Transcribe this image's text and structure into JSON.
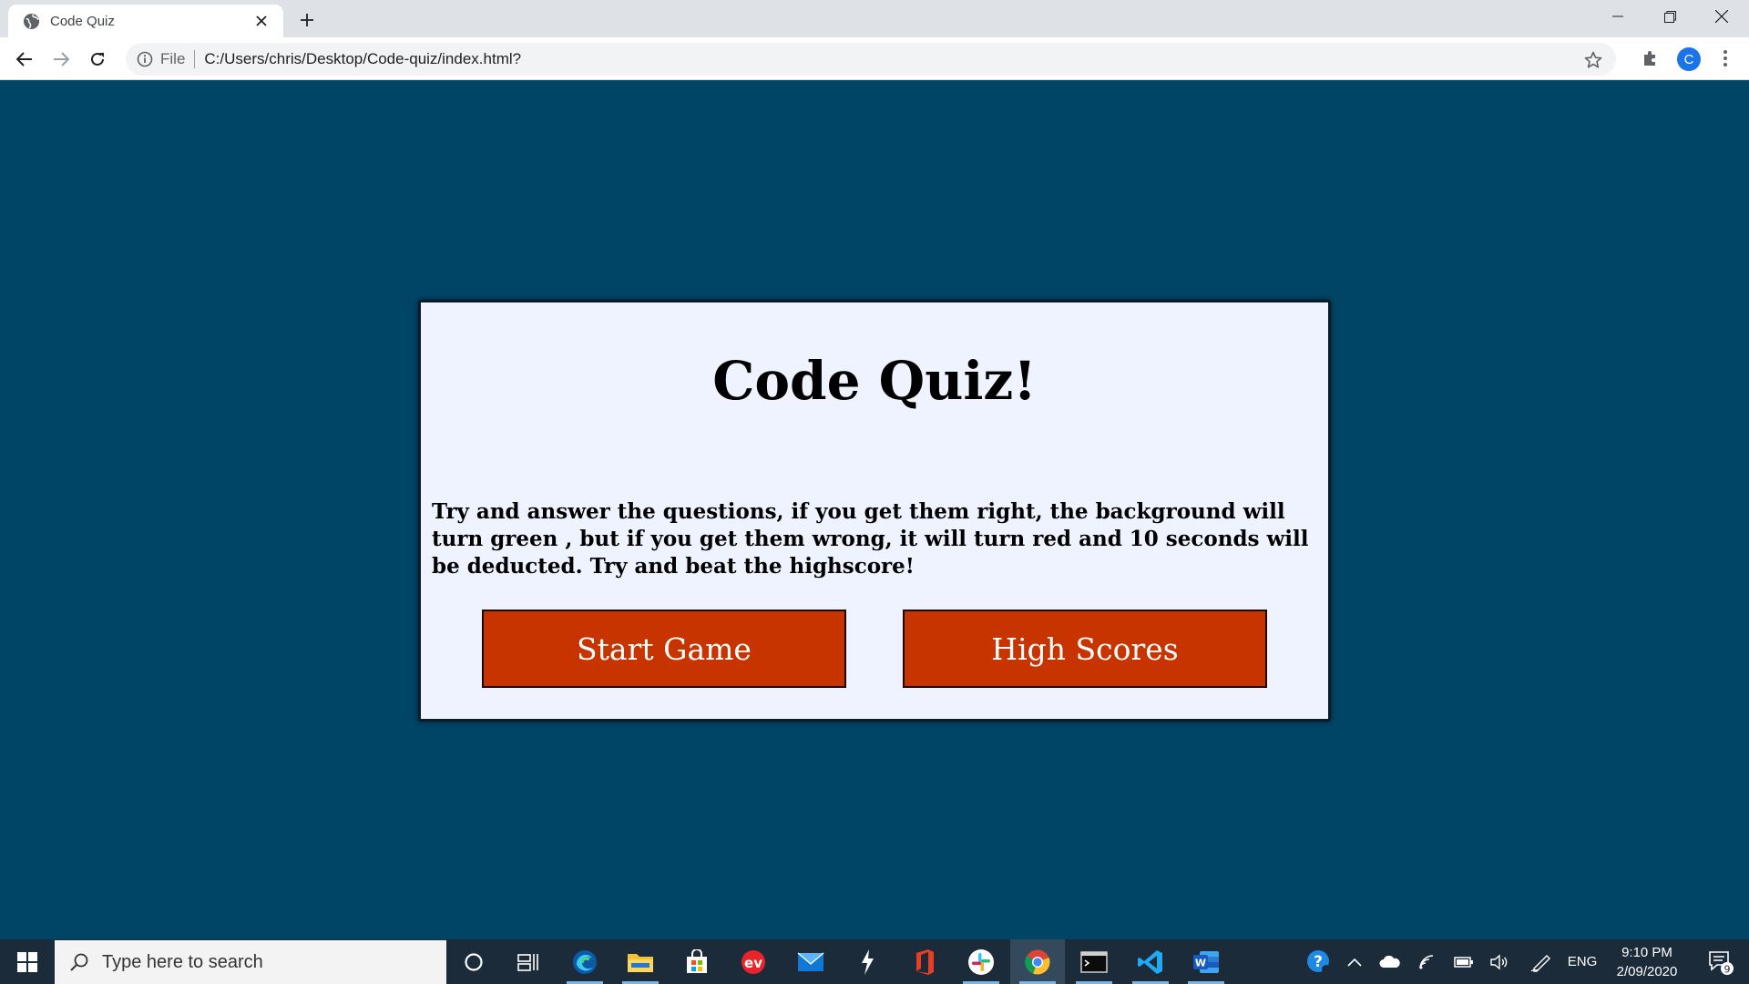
{
  "browser": {
    "tab_title": "Code Quiz",
    "url_scheme_label": "File",
    "url": "C:/Users/chris/Desktop/Code-quiz/index.html?",
    "profile_initial": "C"
  },
  "page": {
    "title": "Code Quiz!",
    "description": "Try and answer the questions, if you get them right, the background will turn green , but if you get them wrong, it will turn red and 10 seconds will be deducted. Try and beat the highscore!",
    "buttons": {
      "start": "Start Game",
      "high_scores": "High Scores"
    }
  },
  "colors": {
    "page_background": "#004466",
    "card_background": "#eef3ff",
    "button_background": "#c83400"
  },
  "taskbar": {
    "search_placeholder": "Type here to search",
    "apps": [
      "cortana-icon",
      "task-view-icon",
      "edge-icon",
      "file-explorer-icon",
      "store-icon",
      "app-red-icon",
      "mail-icon",
      "app-lightning-icon",
      "office-icon",
      "slack-icon",
      "chrome-icon",
      "terminal-icon",
      "vscode-icon",
      "word-icon"
    ],
    "language": "ENG",
    "time": "9:10 PM",
    "date": "2/09/2020",
    "notification_count": "9"
  }
}
